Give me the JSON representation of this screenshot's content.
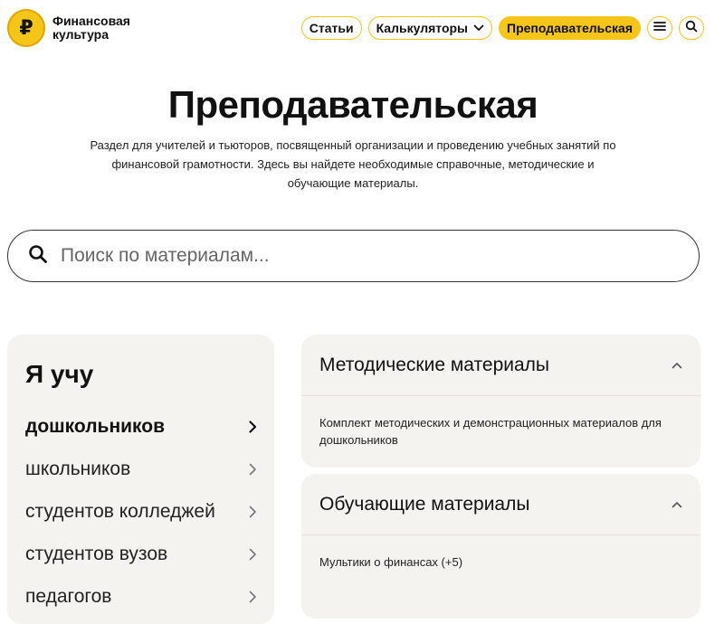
{
  "header": {
    "logo_symbol": "₽",
    "logo_text": "Финансовая культура",
    "nav": {
      "articles": "Статьи",
      "calculators": "Калькуляторы",
      "teachers": "Преподавательская"
    },
    "icons": [
      "menu-icon",
      "search-icon",
      "chevron-down-icon"
    ],
    "accent_color": "#f5c518"
  },
  "page": {
    "title": "Преподавательская",
    "subtitle": "Раздел для учителей и тьюторов, посвященный организации и проведению учебных занятий по финансовой грамотности. Здесь вы найдете необходимые справочные, методические и обучающие материалы."
  },
  "search": {
    "placeholder": "Поиск по материалам..."
  },
  "audience": {
    "title": "Я учу",
    "items": [
      {
        "label": "дошкольников",
        "active": true
      },
      {
        "label": "школьников",
        "active": false
      },
      {
        "label": "студентов колледжей",
        "active": false
      },
      {
        "label": "студентов вузов",
        "active": false
      },
      {
        "label": "педагогов",
        "active": false
      }
    ]
  },
  "sections": [
    {
      "title": "Методические материалы",
      "content": "Комплект методических и демонстрационных материалов для дошкольников"
    },
    {
      "title": "Обучающие материалы",
      "content": "Мультики о финансах (+5)"
    }
  ]
}
